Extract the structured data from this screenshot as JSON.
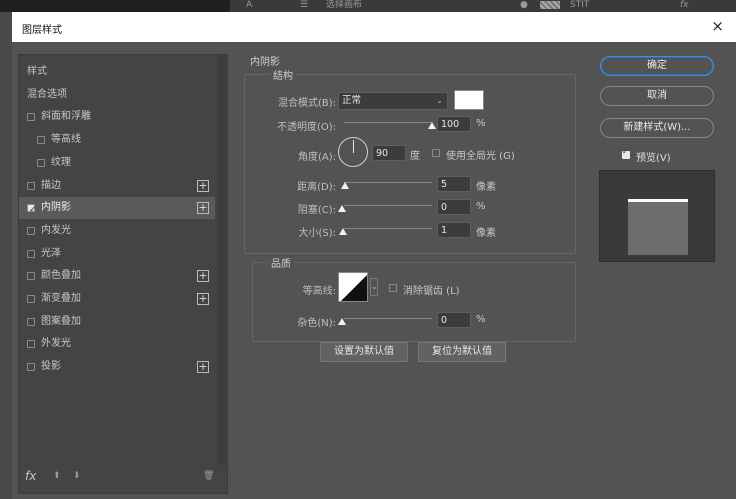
{
  "underlying": {
    "item1": "选择画布",
    "item2": "STIT",
    "item3": "fx"
  },
  "dialog": {
    "title": "图层样式",
    "close": "×"
  },
  "styles_panel": {
    "items": [
      {
        "label": "样式",
        "checkbox": false,
        "checked": false,
        "plus": false,
        "indent": 0,
        "selected": false
      },
      {
        "label": "混合选项",
        "checkbox": false,
        "checked": false,
        "plus": false,
        "indent": 0,
        "selected": false
      },
      {
        "label": "斜面和浮雕",
        "checkbox": true,
        "checked": false,
        "plus": false,
        "indent": 0,
        "selected": false
      },
      {
        "label": "等高线",
        "checkbox": true,
        "checked": false,
        "plus": false,
        "indent": 1,
        "selected": false
      },
      {
        "label": "纹理",
        "checkbox": true,
        "checked": false,
        "plus": false,
        "indent": 1,
        "selected": false
      },
      {
        "label": "描边",
        "checkbox": true,
        "checked": false,
        "plus": true,
        "indent": 0,
        "selected": false
      },
      {
        "label": "内阴影",
        "checkbox": true,
        "checked": true,
        "plus": true,
        "indent": 0,
        "selected": true
      },
      {
        "label": "内发光",
        "checkbox": true,
        "checked": false,
        "plus": false,
        "indent": 0,
        "selected": false
      },
      {
        "label": "光泽",
        "checkbox": true,
        "checked": false,
        "plus": false,
        "indent": 0,
        "selected": false
      },
      {
        "label": "颜色叠加",
        "checkbox": true,
        "checked": false,
        "plus": true,
        "indent": 0,
        "selected": false
      },
      {
        "label": "渐变叠加",
        "checkbox": true,
        "checked": false,
        "plus": true,
        "indent": 0,
        "selected": false
      },
      {
        "label": "图案叠加",
        "checkbox": true,
        "checked": false,
        "plus": false,
        "indent": 0,
        "selected": false
      },
      {
        "label": "外发光",
        "checkbox": true,
        "checked": false,
        "plus": false,
        "indent": 0,
        "selected": false
      },
      {
        "label": "投影",
        "checkbox": true,
        "checked": false,
        "plus": true,
        "indent": 0,
        "selected": false
      }
    ],
    "plus_symbol": "+",
    "fx_label": "fx",
    "up_arrow": "⬆",
    "down_arrow": "⬇",
    "trash": "🗑"
  },
  "inner_shadow": {
    "section_title": "内阴影",
    "structure_title": "结构",
    "blend_mode_label": "混合模式(B):",
    "blend_mode_value": "正常",
    "shadow_color": "#ffffff",
    "opacity_label": "不透明度(O):",
    "opacity_value": "100",
    "opacity_unit": "%",
    "opacity_fraction": 1.0,
    "angle_label": "角度(A):",
    "angle_value": "90",
    "angle_unit": "度",
    "global_light_label": "使用全局光 (G)",
    "global_light_checked": false,
    "distance_label": "距离(D):",
    "distance_value": "5",
    "distance_unit": "像素",
    "choke_label": "阻塞(C):",
    "choke_value": "0",
    "choke_unit": "%",
    "size_label": "大小(S):",
    "size_value": "1",
    "size_unit": "像素",
    "quality_title": "品质",
    "contour_label": "等高线:",
    "antialias_label": "消除锯齿 (L)",
    "antialias_checked": false,
    "noise_label": "杂色(N):",
    "noise_value": "0",
    "noise_unit": "%",
    "set_default_label": "设置为默认值",
    "reset_default_label": "复位为默认值"
  },
  "right_panel": {
    "ok_label": "确定",
    "cancel_label": "取消",
    "new_style_label": "新建样式(W)...",
    "preview_label": "预览(V)",
    "preview_checked": true
  },
  "colors": {
    "accent": "#4d8ad6",
    "dialog_bg": "#535353",
    "panel_bg": "#444444"
  }
}
